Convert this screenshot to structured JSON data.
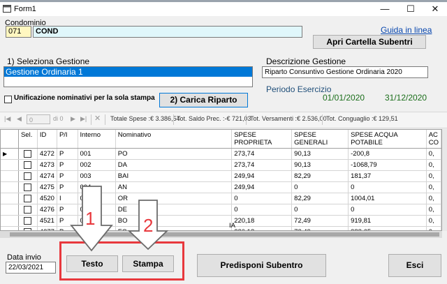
{
  "window": {
    "title": "Form1",
    "min": "—",
    "max": "☐",
    "close": "✕"
  },
  "condominio": {
    "label": "Condominio",
    "code": "071",
    "name": "COND"
  },
  "guida_link": "Guida in linea",
  "apri_button": "Apri Cartella Subentri",
  "gestione": {
    "label": "1) Seleziona Gestione",
    "selected": "Gestione Ordinaria 1"
  },
  "descrizione": {
    "label": "Descrizione Gestione",
    "value": "Riparto Consuntivo Gestione Ordinaria 2020"
  },
  "periodo": {
    "label": "Periodo Esercizio",
    "start": "01/01/2020",
    "end": "31/12/2020"
  },
  "unificazione_label": "Unificazione nominativi per la sola stampa",
  "carica_button": "2) Carica Riparto",
  "navigator": {
    "position": "0",
    "of": "di 0",
    "totals": [
      "Totale Spese :€ 3.386,54",
      "Tot. Saldo Prec. :-€ 721,03",
      "Tot. Versamenti :€ 2.536,00",
      "Tot. Conguaglio :€ 129,51"
    ]
  },
  "table": {
    "columns": [
      "Sel.",
      "ID",
      "P/I",
      "Interno",
      "Nominativo",
      "SPESE PROPRIETA",
      "SPESE GENERALI",
      "SPESE ACQUA POTABILE",
      "AC CO"
    ],
    "rows": [
      [
        "4272",
        "P",
        "001",
        "PO",
        "273,74",
        "90,13",
        "-200,8",
        "0,"
      ],
      [
        "4273",
        "P",
        "002",
        "DA",
        "273,74",
        "90,13",
        "-1068,79",
        "0,"
      ],
      [
        "4274",
        "P",
        "003",
        "BAI",
        "249,94",
        "82,29",
        "181,37",
        "0,"
      ],
      [
        "4275",
        "P",
        "004",
        "AN",
        "249,94",
        "0",
        "0",
        "0,"
      ],
      [
        "4520",
        "I",
        "004",
        "OR",
        "0",
        "82,29",
        "1004,01",
        "0,"
      ],
      [
        "4276",
        "P",
        "005",
        "DE",
        "0",
        "0",
        "0",
        "0,"
      ],
      [
        "4521",
        "P",
        "006",
        "BO",
        "220,18",
        "72,49",
        "919,81",
        "0,"
      ],
      [
        "4277",
        "P",
        "007",
        "FO",
        "220,18",
        "72,49",
        "388,65",
        "0,"
      ]
    ],
    "partial_text": "IA"
  },
  "data_invio": {
    "label": "Data invio",
    "value": "22/03/2021"
  },
  "buttons": {
    "testo": "Testo",
    "stampa": "Stampa",
    "predisponi": "Predisponi Subentro",
    "esci": "Esci"
  },
  "annotations": {
    "one": "1",
    "two": "2"
  },
  "colors": {
    "red": "#e8383d",
    "selection": "#0078d7",
    "cyan_field": "#e0f7fb"
  }
}
